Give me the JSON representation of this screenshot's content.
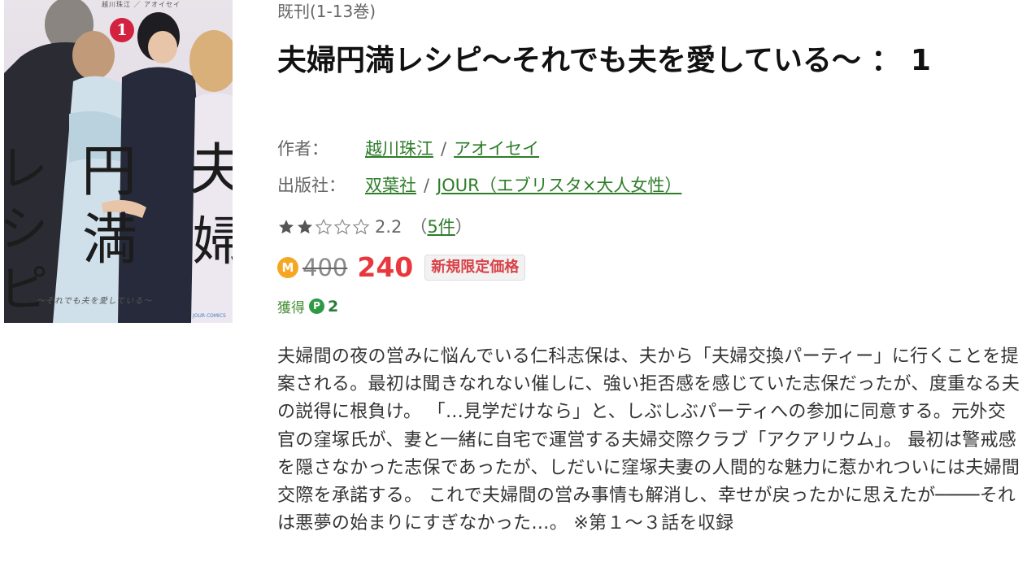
{
  "cover": {
    "volume_number": "1",
    "title_chars": [
      "円",
      "満",
      "夫",
      "婦",
      "レ",
      "シ",
      "ピ"
    ],
    "author_strip": "越川珠江 ／ アオイセイ",
    "subtitle": "〜それでも夫を愛している〜",
    "label": "JOUR COMICS"
  },
  "book": {
    "series_status": "既刊(1-13巻)",
    "title": "夫婦円満レシピ〜それでも夫を愛している〜 ： 1",
    "author_label": "作者：",
    "authors": [
      "越川珠江",
      "アオイセイ"
    ],
    "publisher_label": "出版社：",
    "publishers": [
      "双葉社",
      "JOUR（エブリスタ×大人女性）"
    ],
    "separator": "/",
    "rating": {
      "value": "2.2",
      "stars_filled": 2,
      "stars_total": 5,
      "count_open": "（",
      "count_link": "5件",
      "count_close": "）"
    },
    "price": {
      "coin_icon": "M",
      "original": "400",
      "sale": "240",
      "badge": "新規限定価格"
    },
    "points": {
      "label": "獲得",
      "icon": "P",
      "value": "2"
    },
    "description": "夫婦間の夜の営みに悩んでいる仁科志保は、夫から「夫婦交換パーティー」に行くことを提案される。最初は聞きなれない催しに、強い拒否感を感じていた志保だったが、度重なる夫の説得に根負け。 「…見学だけなら」と、しぶしぶパーティへの参加に同意する。元外交官の窪塚氏が、妻と一緒に自宅で運営する夫婦交際クラブ「アクアリウム」。 最初は警戒感を隠さなかった志保であったが、しだいに窪塚夫妻の人間的な魅力に惹かれついには夫婦間交際を承諾する。 これで夫婦間の営み事情も解消し、幸せが戻ったかに思えたが────それは悪夢の始まりにすぎなかった…。 ※第１〜３話を収録"
  },
  "colors": {
    "link": "#2e7d2a",
    "sale_price": "#e8383d",
    "coin": "#f5a623",
    "point_icon": "#2f9a46",
    "badge_text": "#d84247"
  }
}
